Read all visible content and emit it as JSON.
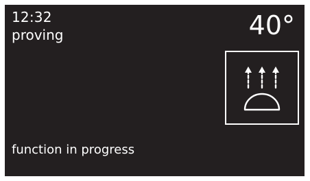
{
  "display": {
    "time": "12:32",
    "mode": "proving",
    "temperature": "40°",
    "status": "function in progress",
    "mode_icon": "proving-dough-icon"
  },
  "colors": {
    "screen_background": "#231f20",
    "text": "#ffffff"
  }
}
